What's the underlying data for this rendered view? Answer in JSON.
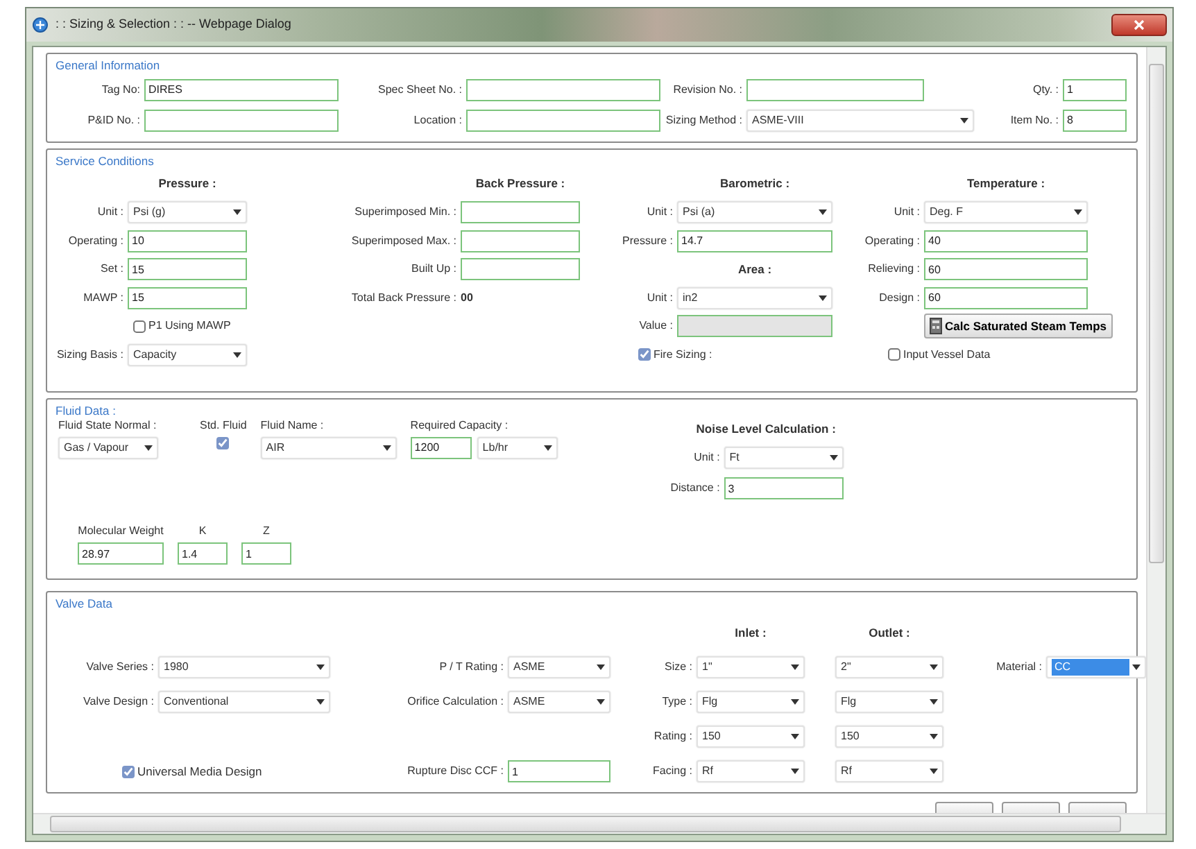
{
  "window": {
    "title": ": : Sizing & Selection : : -- Webpage Dialog"
  },
  "sections": [
    {
      "kind": "grid",
      "title": "General Information",
      "columns": [
        [
          {
            "kind": "text",
            "label": "Tag No:",
            "value": "DIRES"
          },
          {
            "kind": "text",
            "label": "P&ID No. :"
          }
        ],
        [
          {
            "kind": "text",
            "label": "Spec Sheet No. :"
          },
          {
            "kind": "text",
            "label": "Location :"
          }
        ],
        [
          {
            "kind": "text",
            "label": "Revision No. :"
          },
          {
            "kind": "select",
            "label": "Sizing Method :",
            "value": "ASME-VIII"
          }
        ],
        [
          {
            "kind": "text",
            "label": "Qty. :",
            "value": "1"
          },
          {
            "kind": "text",
            "label": "Item No. :",
            "value": "8"
          }
        ]
      ]
    },
    {
      "kind": "grid",
      "title": "Service Conditions",
      "columns": [
        [
          {
            "kind": "heading",
            "label": "Pressure :"
          },
          {
            "kind": "select",
            "label": "Unit :",
            "value": "Psi (g)"
          },
          {
            "kind": "text",
            "label": "Operating :",
            "value": "10"
          },
          {
            "kind": "text",
            "label": "Set :",
            "value": "15"
          },
          {
            "kind": "text",
            "label": "MAWP :",
            "value": "15"
          },
          {
            "kind": "check",
            "label": "P1 Using MAWP",
            "checked": false
          },
          {
            "kind": "select",
            "label": "Sizing Basis :",
            "value": "Capacity"
          }
        ],
        [
          {
            "kind": "heading",
            "label": "Back Pressure :"
          },
          {
            "kind": "text",
            "label": "Superimposed Min. :"
          },
          {
            "kind": "text",
            "label": "Superimposed Max. :"
          },
          {
            "kind": "text",
            "label": "Built Up :"
          },
          {
            "kind": "static",
            "label": "Total Back Pressure :",
            "value": "00"
          }
        ],
        [
          {
            "kind": "heading",
            "label": "Barometric :"
          },
          {
            "kind": "select",
            "label": "Unit :",
            "value": "Psi (a)"
          },
          {
            "kind": "text",
            "label": "Pressure :",
            "value": "14.7"
          },
          {
            "kind": "heading",
            "label": "Area :"
          },
          {
            "kind": "select",
            "label": "Unit :",
            "value": "in2"
          },
          {
            "kind": "text",
            "label": "Value :",
            "disabled": true
          },
          {
            "kind": "check",
            "label": "Fire Sizing :",
            "checked": true
          }
        ],
        [
          {
            "kind": "heading",
            "label": "Temperature :"
          },
          {
            "kind": "select",
            "label": "Unit :",
            "value": "Deg. F"
          },
          {
            "kind": "text",
            "label": "Operating :",
            "value": "40"
          },
          {
            "kind": "text",
            "label": "Relieving :",
            "value": "60"
          },
          {
            "kind": "text",
            "label": "Design :",
            "value": "60"
          },
          {
            "kind": "button",
            "label": "Calc Saturated Steam Temps"
          },
          {
            "kind": "check",
            "label": "Input Vessel Data",
            "checked": false
          }
        ]
      ]
    },
    {
      "kind": "fluid",
      "title": "Fluid Data :",
      "top": [
        {
          "kind": "select",
          "label": "Fluid State Normal :",
          "value": "Gas / Vapour"
        },
        {
          "kind": "check",
          "label": "Std. Fluid",
          "checked": true
        },
        {
          "kind": "select",
          "label": "Fluid Name :",
          "value": "AIR"
        },
        {
          "kind": "text_unit",
          "label": "Required Capacity :",
          "value": "1200",
          "unit": "Lb/hr"
        }
      ],
      "noise": {
        "title": "Noise Level Calculation :",
        "fields": [
          {
            "kind": "select",
            "label": "Unit :",
            "value": "Ft"
          },
          {
            "kind": "text",
            "label": "Distance :",
            "value": "3"
          }
        ]
      },
      "bottom": [
        {
          "kind": "text",
          "label": "Molecular Weight",
          "value": "28.97"
        },
        {
          "kind": "text",
          "label": "K",
          "value": "1.4"
        },
        {
          "kind": "text",
          "label": "Z",
          "value": "1"
        }
      ]
    },
    {
      "kind": "grid",
      "title": "Valve Data",
      "columns": [
        [
          {
            "kind": "select",
            "label": "Valve Series :",
            "value": "1980"
          },
          {
            "kind": "select",
            "label": "Valve Design :",
            "value": "Conventional"
          },
          {
            "kind": "check",
            "label": "Universal Media Design",
            "checked": true
          }
        ],
        [
          {
            "kind": "select",
            "label": "P / T Rating :",
            "value": "ASME"
          },
          {
            "kind": "select",
            "label": "Orifice Calculation :",
            "value": "ASME"
          },
          {
            "kind": "text",
            "label": "Rupture Disc CCF :",
            "value": "1"
          }
        ],
        [
          {
            "kind": "heading",
            "label": "Inlet :"
          },
          {
            "kind": "select",
            "label": "Size :",
            "value": "1\""
          },
          {
            "kind": "select",
            "label": "Type :",
            "value": "Flg"
          },
          {
            "kind": "select",
            "label": "Rating :",
            "value": "150"
          },
          {
            "kind": "select",
            "label": "Facing :",
            "value": "Rf"
          }
        ],
        [
          {
            "kind": "heading",
            "label": "Outlet :"
          },
          {
            "kind": "select",
            "value": "2\""
          },
          {
            "kind": "select",
            "value": "Flg"
          },
          {
            "kind": "select",
            "value": "150"
          },
          {
            "kind": "select",
            "value": "Rf"
          }
        ],
        [
          {
            "kind": "select",
            "label": "Material :",
            "value": "CC",
            "highlighted": true
          }
        ]
      ]
    }
  ]
}
